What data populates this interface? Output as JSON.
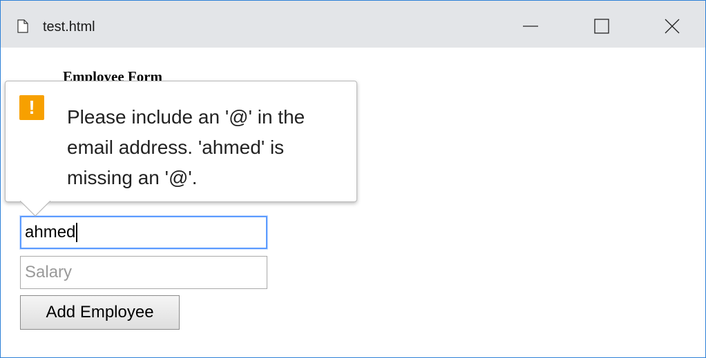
{
  "window": {
    "title": "test.html",
    "file_icon": "document-icon",
    "minimize_icon": "minimize-icon",
    "maximize_icon": "maximize-icon",
    "close_icon": "close-icon"
  },
  "form": {
    "heading": "Employee Form",
    "email_value": "ahmed",
    "salary_placeholder": "Salary",
    "submit_label": "Add Employee"
  },
  "validation_tooltip": {
    "icon": "warning-icon",
    "icon_glyph": "!",
    "message": "Please include an '@' in the email address. 'ahmed' is missing an '@'."
  },
  "colors": {
    "titlebar_bg": "#e3e5e8",
    "window_border": "#2b7fd6",
    "focus_border": "#5b9bff",
    "warning": "#f7a000"
  }
}
